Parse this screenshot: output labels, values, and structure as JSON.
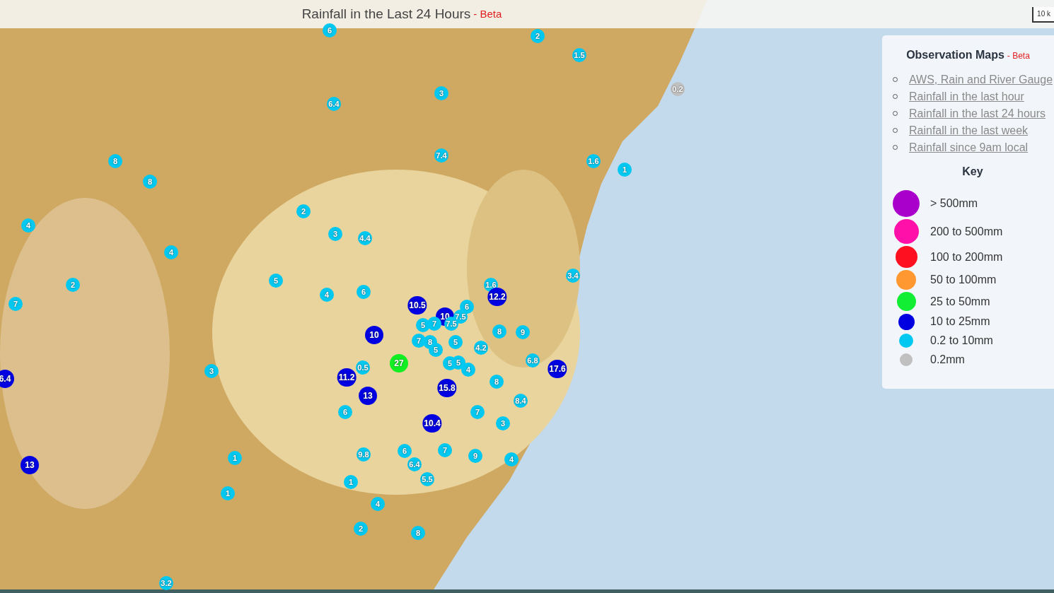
{
  "header": {
    "title": "Rainfall in the Last 24 Hours",
    "badge": "- Beta"
  },
  "scale": {
    "label": "10 k"
  },
  "markers": [
    {
      "value": "6",
      "color": "#00c8f0"
    },
    {
      "value": "2",
      "color": "#00c8f0"
    },
    {
      "value": "1.5",
      "color": "#00c8f0"
    },
    {
      "value": "0.2",
      "color": "#c0c0c0"
    },
    {
      "value": "3",
      "color": "#00c8f0"
    },
    {
      "value": "6.4",
      "color": "#00c8f0"
    },
    {
      "value": "7.4",
      "color": "#00c8f0"
    },
    {
      "value": "8",
      "color": "#00c8f0"
    },
    {
      "value": "1.6",
      "color": "#00c8f0"
    },
    {
      "value": "1",
      "color": "#00c8f0"
    },
    {
      "value": "8",
      "color": "#00c8f0"
    },
    {
      "value": "2",
      "color": "#00c8f0"
    },
    {
      "value": "4",
      "color": "#00c8f0"
    },
    {
      "value": "3",
      "color": "#00c8f0"
    },
    {
      "value": "4.4",
      "color": "#00c8f0"
    },
    {
      "value": "4",
      "color": "#00c8f0"
    },
    {
      "value": "3.4",
      "color": "#00c8f0"
    },
    {
      "value": "5",
      "color": "#00c8f0"
    },
    {
      "value": "2",
      "color": "#00c8f0"
    },
    {
      "value": "1.6",
      "color": "#00c8f0"
    },
    {
      "value": "4",
      "color": "#00c8f0"
    },
    {
      "value": "6",
      "color": "#00c8f0"
    },
    {
      "value": "12.2",
      "color": "#0000e0"
    },
    {
      "value": "7",
      "color": "#00c8f0"
    },
    {
      "value": "10.5",
      "color": "#0000e0"
    },
    {
      "value": "6",
      "color": "#00c8f0"
    },
    {
      "value": "10",
      "color": "#0000e0"
    },
    {
      "value": "7.5",
      "color": "#00c8f0"
    },
    {
      "value": "5",
      "color": "#00c8f0"
    },
    {
      "value": "7",
      "color": "#00c8f0"
    },
    {
      "value": "7.5",
      "color": "#00c8f0"
    },
    {
      "value": "10",
      "color": "#0000e0"
    },
    {
      "value": "8",
      "color": "#00c8f0"
    },
    {
      "value": "9",
      "color": "#00c8f0"
    },
    {
      "value": "7",
      "color": "#00c8f0"
    },
    {
      "value": "8",
      "color": "#00c8f0"
    },
    {
      "value": "5",
      "color": "#00c8f0"
    },
    {
      "value": "5",
      "color": "#00c8f0"
    },
    {
      "value": "4.2",
      "color": "#00c8f0"
    },
    {
      "value": "27",
      "color": "#11ee22"
    },
    {
      "value": "5",
      "color": "#00c8f0"
    },
    {
      "value": "5",
      "color": "#00c8f0"
    },
    {
      "value": "6.8",
      "color": "#00c8f0"
    },
    {
      "value": "3",
      "color": "#00c8f0"
    },
    {
      "value": "0.5",
      "color": "#00c8f0"
    },
    {
      "value": "4",
      "color": "#00c8f0"
    },
    {
      "value": "17.6",
      "color": "#0000e0"
    },
    {
      "value": "6.4",
      "color": "#0000e0"
    },
    {
      "value": "11.2",
      "color": "#0000e0"
    },
    {
      "value": "8",
      "color": "#00c8f0"
    },
    {
      "value": "15.8",
      "color": "#0000e0"
    },
    {
      "value": "13",
      "color": "#0000e0"
    },
    {
      "value": "8.4",
      "color": "#00c8f0"
    },
    {
      "value": "6",
      "color": "#00c8f0"
    },
    {
      "value": "7",
      "color": "#00c8f0"
    },
    {
      "value": "10.4",
      "color": "#0000e0"
    },
    {
      "value": "3",
      "color": "#00c8f0"
    },
    {
      "value": "6",
      "color": "#00c8f0"
    },
    {
      "value": "7",
      "color": "#00c8f0"
    },
    {
      "value": "1",
      "color": "#00c8f0"
    },
    {
      "value": "9.8",
      "color": "#00c8f0"
    },
    {
      "value": "9",
      "color": "#00c8f0"
    },
    {
      "value": "4",
      "color": "#00c8f0"
    },
    {
      "value": "13",
      "color": "#0000e0"
    },
    {
      "value": "6.4",
      "color": "#00c8f0"
    },
    {
      "value": "5.5",
      "color": "#00c8f0"
    },
    {
      "value": "1",
      "color": "#00c8f0"
    },
    {
      "value": "1",
      "color": "#00c8f0"
    },
    {
      "value": "4",
      "color": "#00c8f0"
    },
    {
      "value": "2",
      "color": "#00c8f0"
    },
    {
      "value": "8",
      "color": "#00c8f0"
    },
    {
      "value": "3.2",
      "color": "#00c8f0"
    }
  ],
  "panel": {
    "title": "Observation Maps",
    "badge": "- Beta",
    "links": [
      "AWS, Rain and River Gauge",
      "Rainfall in the last hour",
      "Rainfall in the last 24 hours",
      "Rainfall in the last week",
      "Rainfall since 9am local"
    ],
    "key_title": "Key",
    "key": [
      {
        "label": "> 500mm",
        "color": "#aa00cc"
      },
      {
        "label": "200 to 500mm",
        "color": "#ff10a8"
      },
      {
        "label": "100 to 200mm",
        "color": "#ff1020"
      },
      {
        "label": "50 to 100mm",
        "color": "#ff9830"
      },
      {
        "label": "25 to 50mm",
        "color": "#11ee33"
      },
      {
        "label": "10 to 25mm",
        "color": "#0000e0"
      },
      {
        "label": "0.2 to 10mm",
        "color": "#00c8f0"
      },
      {
        "label": "0.2mm",
        "color": "#c0c0c0"
      }
    ]
  }
}
